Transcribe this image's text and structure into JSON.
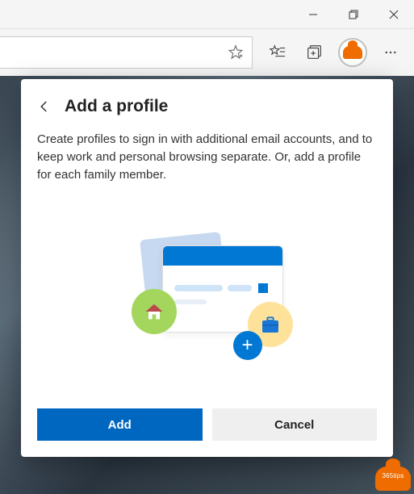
{
  "dialog": {
    "title": "Add a profile",
    "description": "Create profiles to sign in with additional email accounts, and to keep work and personal browsing separate. Or, add a profile for each family member.",
    "add_label": "Add",
    "cancel_label": "Cancel"
  },
  "badge": {
    "text": "365tips"
  }
}
